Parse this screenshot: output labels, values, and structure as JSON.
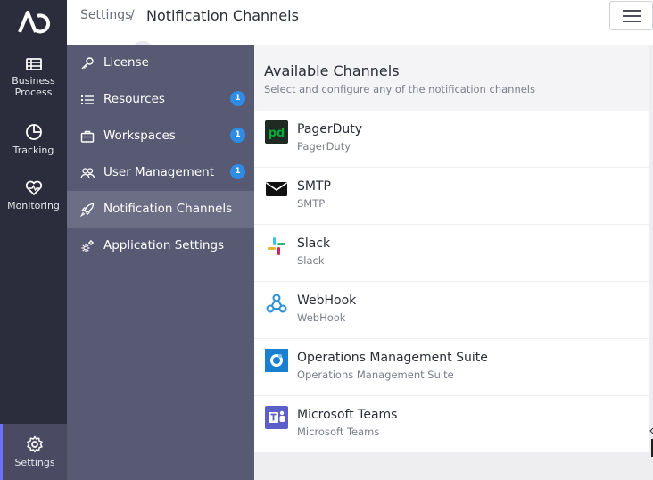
{
  "rail": {
    "items": [
      {
        "label_line1": "Business",
        "label_line2": "Process",
        "icon": "business-process-icon"
      },
      {
        "label": "Tracking",
        "icon": "tracking-icon"
      },
      {
        "label": "Monitoring",
        "icon": "monitoring-icon"
      },
      {
        "label": "Settings",
        "icon": "gear-icon",
        "active": true
      }
    ]
  },
  "breadcrumb": {
    "root": "Settings",
    "separator": "/",
    "current": "Notification Channels"
  },
  "nav": {
    "items": [
      {
        "label": "License",
        "icon": "key-icon"
      },
      {
        "label": "Resources",
        "icon": "list-icon",
        "badge": "1"
      },
      {
        "label": "Workspaces",
        "icon": "briefcase-icon",
        "badge": "1"
      },
      {
        "label": "User Management",
        "icon": "users-icon",
        "badge": "1"
      },
      {
        "label": "Notification Channels",
        "icon": "rocket-icon",
        "active": true
      },
      {
        "label": "Application Settings",
        "icon": "cogs-icon"
      }
    ]
  },
  "main": {
    "title": "Available Channels",
    "subtitle": "Select and configure any of the notification channels",
    "channels": [
      {
        "name": "PagerDuty",
        "desc": "PagerDuty",
        "icon": "pagerduty-icon"
      },
      {
        "name": "SMTP",
        "desc": "SMTP",
        "icon": "mail-icon"
      },
      {
        "name": "Slack",
        "desc": "Slack",
        "icon": "slack-icon"
      },
      {
        "name": "WebHook",
        "desc": "WebHook",
        "icon": "webhook-icon"
      },
      {
        "name": "Operations Management Suite",
        "desc": "Operations Management Suite",
        "icon": "oms-icon"
      },
      {
        "name": "Microsoft Teams",
        "desc": "Microsoft Teams",
        "icon": "teams-icon"
      }
    ]
  },
  "colors": {
    "rail_bg": "#2c2d3c",
    "nav_bg": "#585a73",
    "nav_active": "#6c6e86",
    "badge": "#2e8ce6",
    "pagerduty": "#06ac38",
    "teams": "#5b5fc7"
  }
}
